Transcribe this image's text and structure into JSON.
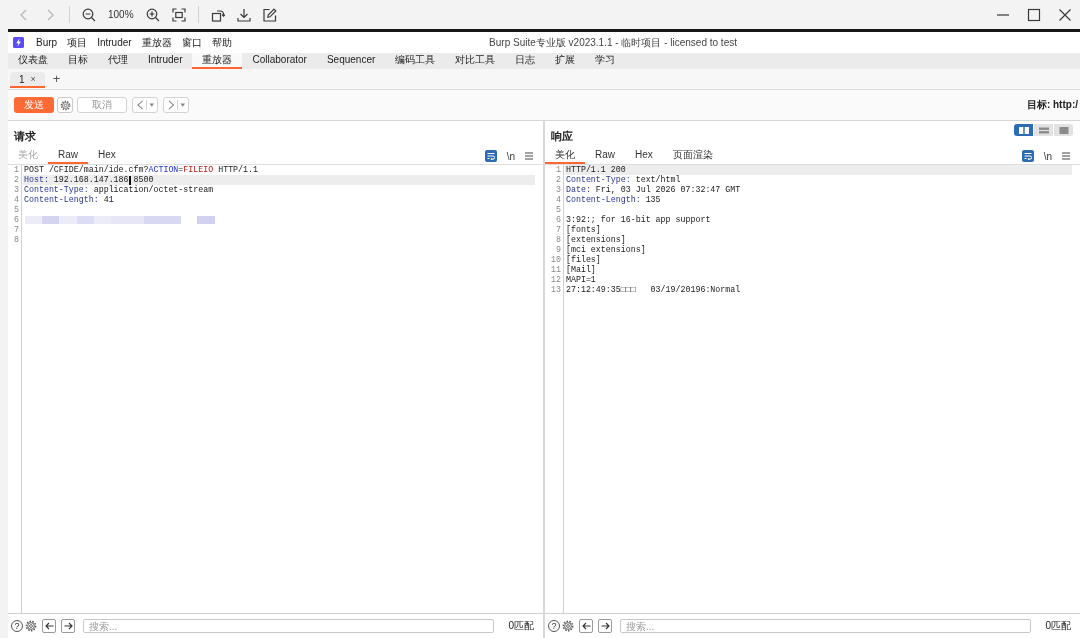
{
  "viewer": {
    "back_disabled": true,
    "forward_disabled": true,
    "zoom": "100%"
  },
  "app": {
    "menu": [
      "Burp",
      "项目",
      "Intruder",
      "重放器",
      "窗口",
      "帮助"
    ],
    "title": "Burp Suite专业版 v2023.1.1 - 临时项目 - licensed to test",
    "tabs": [
      {
        "label": "仪表盘",
        "selected": false
      },
      {
        "label": "目标",
        "selected": false
      },
      {
        "label": "代理",
        "selected": false
      },
      {
        "label": "Intruder",
        "selected": false
      },
      {
        "label": "重放器",
        "selected": true
      },
      {
        "label": "Collaborator",
        "selected": false
      },
      {
        "label": "Sequencer",
        "selected": false
      },
      {
        "label": "编码工具",
        "selected": false
      },
      {
        "label": "对比工具",
        "selected": false
      },
      {
        "label": "日志",
        "selected": false
      },
      {
        "label": "扩展",
        "selected": false
      },
      {
        "label": "学习",
        "selected": false
      }
    ],
    "repeater_tabs": [
      {
        "label": "1",
        "close": "×",
        "selected": true
      }
    ],
    "new_tab": "+",
    "toolbar": {
      "send": "发送",
      "cancel": "取消",
      "target": "目标: http:/"
    },
    "panels": [
      {
        "title": "请求",
        "tabs": [
          {
            "label": "美化",
            "selected": false,
            "disabled": true
          },
          {
            "label": "Raw",
            "selected": true,
            "disabled": false
          },
          {
            "label": "Hex",
            "selected": false,
            "disabled": false
          }
        ],
        "wrap_on": true,
        "newline": "\\n",
        "lines": [
          {
            "number": "1",
            "highlighted": false,
            "segments": [
              {
                "kind": "plain",
                "text": "POST /CFIDE/main/ide.cfm?"
              },
              {
                "kind": "param",
                "text": "ACTION"
              },
              {
                "kind": "plain",
                "text": "="
              },
              {
                "kind": "value",
                "text": "FILEIO"
              },
              {
                "kind": "plain",
                "text": " HTTP/1.1"
              }
            ]
          },
          {
            "number": "2",
            "highlighted": true,
            "segments": [
              {
                "kind": "header",
                "text": "Host:"
              },
              {
                "kind": "plain",
                "text": " 192.168.147.186"
              },
              {
                "kind": "cursor"
              },
              {
                "kind": "plain",
                "text": "8500"
              }
            ]
          },
          {
            "number": "3",
            "highlighted": false,
            "segments": [
              {
                "kind": "header",
                "text": "Content-Type:"
              },
              {
                "kind": "plain",
                "text": " application/octet-stream"
              }
            ]
          },
          {
            "number": "4",
            "highlighted": false,
            "segments": [
              {
                "kind": "header",
                "text": "Content-Length:"
              },
              {
                "kind": "plain",
                "text": " 41"
              }
            ]
          },
          {
            "number": "5",
            "highlighted": false
          },
          {
            "number": "6",
            "highlighted": false,
            "segments": [
              {
                "kind": "blur"
              }
            ]
          },
          {
            "number": "7",
            "highlighted": false
          },
          {
            "number": "8",
            "highlighted": false
          }
        ],
        "help": "?",
        "search": {
          "placeholder": "搜索..."
        },
        "matches": "0匹配"
      },
      {
        "title": "响应",
        "view_modes": [
          {
            "kind": "side-by-side",
            "selected": true
          },
          {
            "kind": "stacked",
            "selected": false
          },
          {
            "kind": "single",
            "selected": false
          }
        ],
        "tabs": [
          {
            "label": "美化",
            "selected": true,
            "disabled": false
          },
          {
            "label": "Raw",
            "selected": false,
            "disabled": false
          },
          {
            "label": "Hex",
            "selected": false,
            "disabled": false
          },
          {
            "label": "页面渲染",
            "selected": false,
            "disabled": false
          }
        ],
        "wrap_on": true,
        "newline": "\\n",
        "lines": [
          {
            "number": "1",
            "highlighted": true,
            "segments": [
              {
                "kind": "plain",
                "text": "HTTP/1.1 200"
              }
            ]
          },
          {
            "number": "2",
            "highlighted": false,
            "segments": [
              {
                "kind": "header",
                "text": "Content-Type:"
              },
              {
                "kind": "plain",
                "text": " text/html"
              }
            ]
          },
          {
            "number": "3",
            "highlighted": false,
            "segments": [
              {
                "kind": "header",
                "text": "Date:"
              },
              {
                "kind": "plain",
                "text": " Fri, 03 Jul 2026 07:32:47 GMT"
              }
            ]
          },
          {
            "number": "4",
            "highlighted": false,
            "segments": [
              {
                "kind": "header",
                "text": "Content-Length:"
              },
              {
                "kind": "plain",
                "text": " 135"
              }
            ]
          },
          {
            "number": "5",
            "highlighted": false
          },
          {
            "number": "6",
            "highlighted": false,
            "segments": [
              {
                "kind": "plain",
                "text": "3:92:; for 16-bit app support"
              }
            ]
          },
          {
            "number": "7",
            "highlighted": false,
            "segments": [
              {
                "kind": "plain",
                "text": "[fonts]"
              }
            ]
          },
          {
            "number": "8",
            "highlighted": false,
            "segments": [
              {
                "kind": "plain",
                "text": "[extensions]"
              }
            ]
          },
          {
            "number": "9",
            "highlighted": false,
            "segments": [
              {
                "kind": "plain",
                "text": "[mci extensions]"
              }
            ]
          },
          {
            "number": "10",
            "highlighted": false,
            "segments": [
              {
                "kind": "plain",
                "text": "[files]"
              }
            ]
          },
          {
            "number": "11",
            "highlighted": false,
            "segments": [
              {
                "kind": "plain",
                "text": "[Mail]"
              }
            ]
          },
          {
            "number": "12",
            "highlighted": false,
            "segments": [
              {
                "kind": "plain",
                "text": "MAPI=1"
              }
            ]
          },
          {
            "number": "13",
            "highlighted": false,
            "segments": [
              {
                "kind": "plain",
                "text": "27:12:49:35□□□   03/19/20196:Normal"
              }
            ]
          }
        ],
        "help": "?",
        "search": {
          "placeholder": "搜索..."
        },
        "matches": "0匹配"
      }
    ]
  }
}
